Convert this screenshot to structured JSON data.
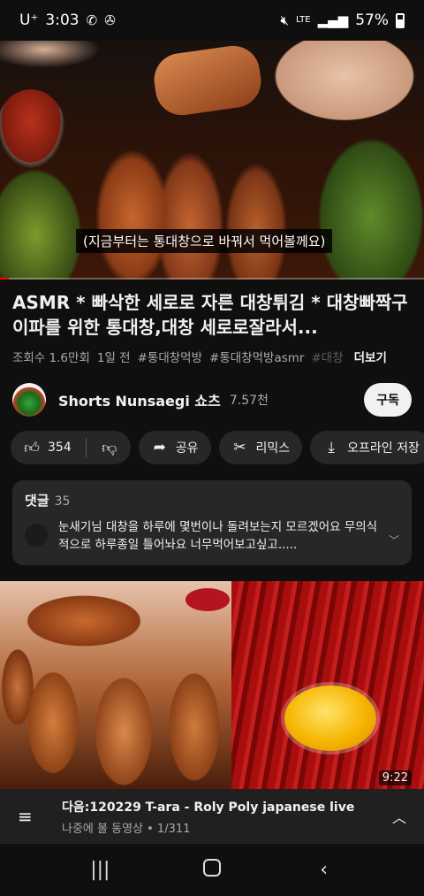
{
  "status_bar": {
    "carrier": "U⁺",
    "time": "3:03",
    "network": "LTE",
    "battery": "57%"
  },
  "player": {
    "subtitle": "(지금부터는 통대창으로 바꿔서 먹어볼께요)",
    "progress_fraction": 0.02
  },
  "video": {
    "title": "ASMR * 빠삭한 세로로 자른 대창튀김 * 대창빠짝구이파를 위한 통대창,대창 세로로잘라서...",
    "views": "조회수 1.6만회",
    "age": "1일 전",
    "hashtags": [
      "#통대창먹방",
      "#통대창먹방asmr",
      "#대창"
    ],
    "more_label": "더보기"
  },
  "channel": {
    "name": "Shorts Nunsaegi 쇼츠",
    "subscribers": "7.57천",
    "subscribe_label": "구독"
  },
  "actions": {
    "likes": "354",
    "share": "공유",
    "remix": "리믹스",
    "download": "오프라인 저장"
  },
  "comments": {
    "label": "댓글",
    "count": "35",
    "top_comment": "눈새기님 대창을 하루에 몇번이나 돌려보는지 모르겠어요 무의식적으로 하루종일 틀어놔요 너무먹어보고싶고....."
  },
  "thumbnail": {
    "duration": "9:22"
  },
  "next_up": {
    "title": "다음:120229 T-ara - Roly Poly japanese live",
    "subtitle": "나중에 볼 동영상 • 1/311"
  }
}
